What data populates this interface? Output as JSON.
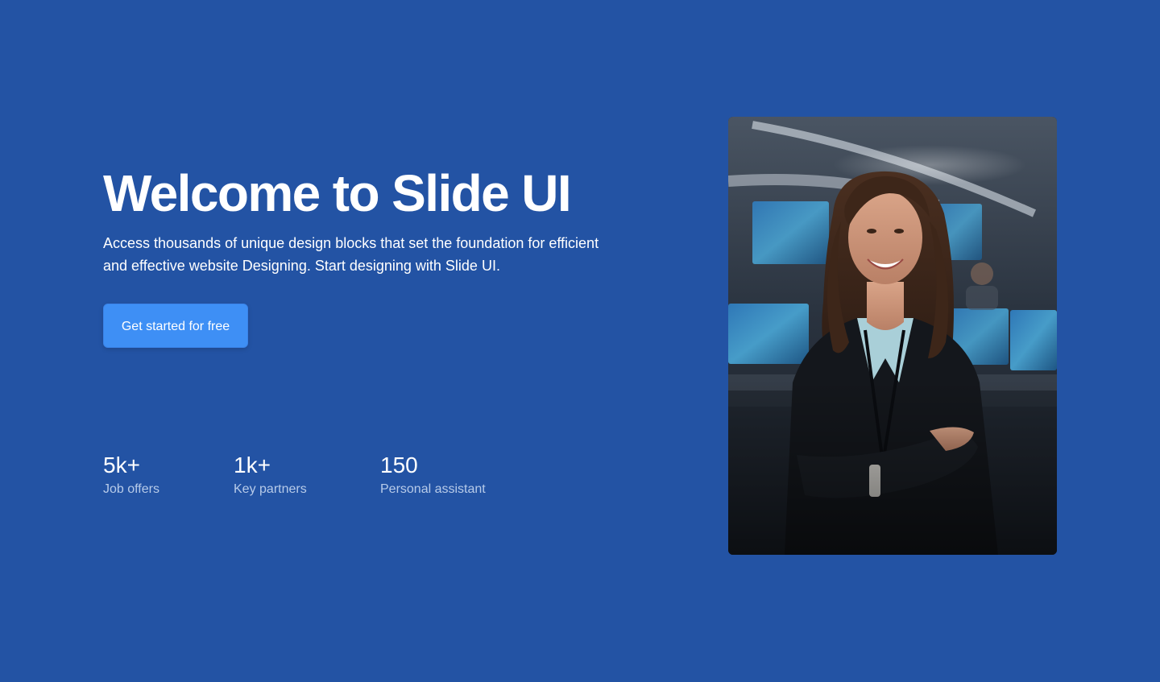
{
  "hero": {
    "title": "Welcome to Slide UI",
    "description": "Access thousands of unique design blocks that set the foundation for efficient and effective website Designing. Start designing with Slide UI.",
    "cta_label": "Get started for free"
  },
  "stats": [
    {
      "value": "5k+",
      "label": "Job offers"
    },
    {
      "value": "1k+",
      "label": "Key partners"
    },
    {
      "value": "150",
      "label": "Personal assistant"
    }
  ],
  "colors": {
    "background": "#2353a4",
    "button": "#3e8ff5",
    "stat_label": "#b7cbe9"
  },
  "image": {
    "subject": "smiling-businesswoman-photo"
  }
}
